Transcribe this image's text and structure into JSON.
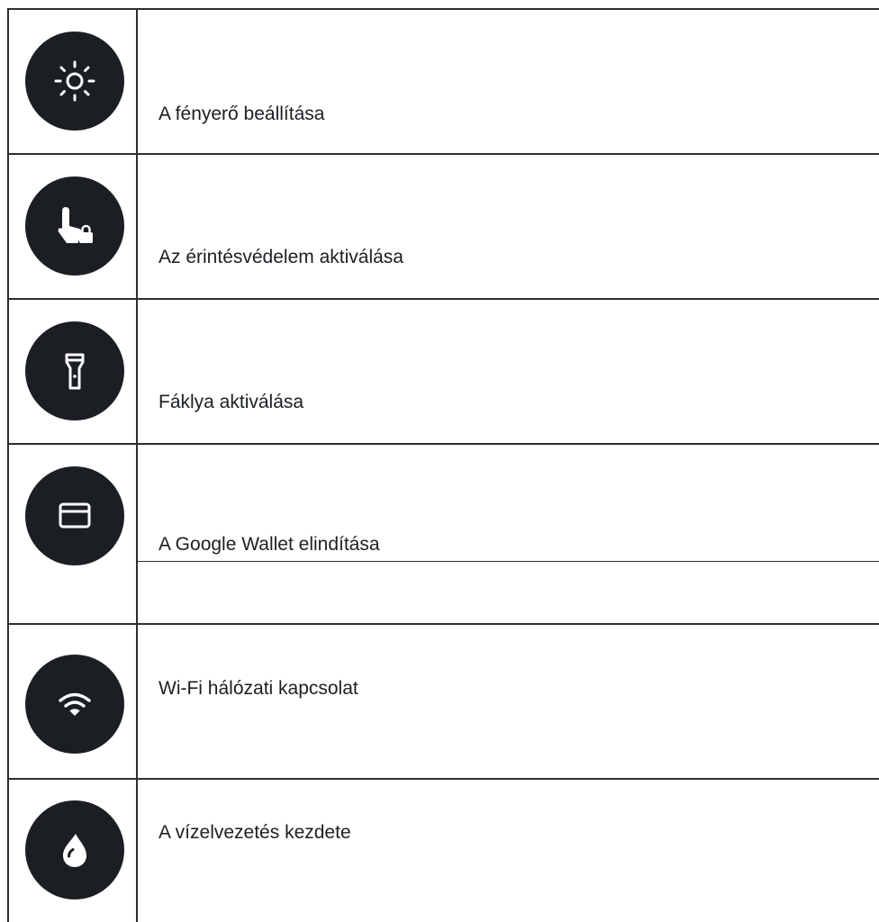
{
  "rows": [
    {
      "label": "A fényerő beállítása",
      "icon": "brightness-icon"
    },
    {
      "label": "Az érintésvédelem aktiválása",
      "icon": "touch-lock-icon"
    },
    {
      "label": "Fáklya aktiválása",
      "icon": "flashlight-icon"
    },
    {
      "label": "A Google Wallet elindítása",
      "icon": "wallet-card-icon"
    },
    {
      "label": "Wi-Fi hálózati kapcsolat",
      "icon": "wifi-icon"
    },
    {
      "label": "A vízelvezetés kezdete",
      "icon": "water-drop-icon"
    }
  ],
  "colors": {
    "icon_background": "#1b1f23",
    "icon_foreground": "#ffffff",
    "grid_lines": "#2b2f33"
  }
}
